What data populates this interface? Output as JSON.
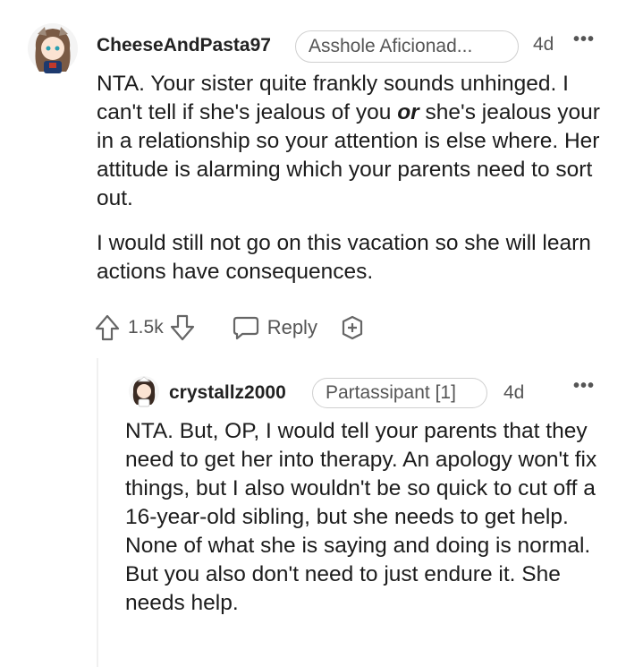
{
  "comments": [
    {
      "username": "CheeseAndPasta97",
      "flair": "Asshole Aficionad...",
      "time": "4d",
      "more": "•••",
      "paragraphs": [
        "NTA. Your sister quite frankly sounds unhinged. I can't tell if she's jealous of you ",
        "or",
        " she's jealous your in a relationship so your attention is else where. Her attitude is alarming which your parents need to sort out.",
        "I would still not go on this vacation so she will learn actions have consequences."
      ],
      "score": "1.5k",
      "reply_label": "Reply"
    },
    {
      "username": "crystallz2000",
      "flair": "Partassipant [1]",
      "time": "4d",
      "more": "•••",
      "text": "NTA. But, OP, I would tell your parents that they need to get her into therapy. An apology won't fix things, but I also wouldn't be so quick to cut off a 16-year-old sibling, but she needs to get help. None of what she is saying and doing is normal. But you also don't need to just endure it. She needs help."
    }
  ],
  "icons": {
    "upvote": "upvote-arrow-icon",
    "downvote": "downvote-arrow-icon",
    "reply": "speech-bubble-icon",
    "award": "award-plus-icon"
  }
}
